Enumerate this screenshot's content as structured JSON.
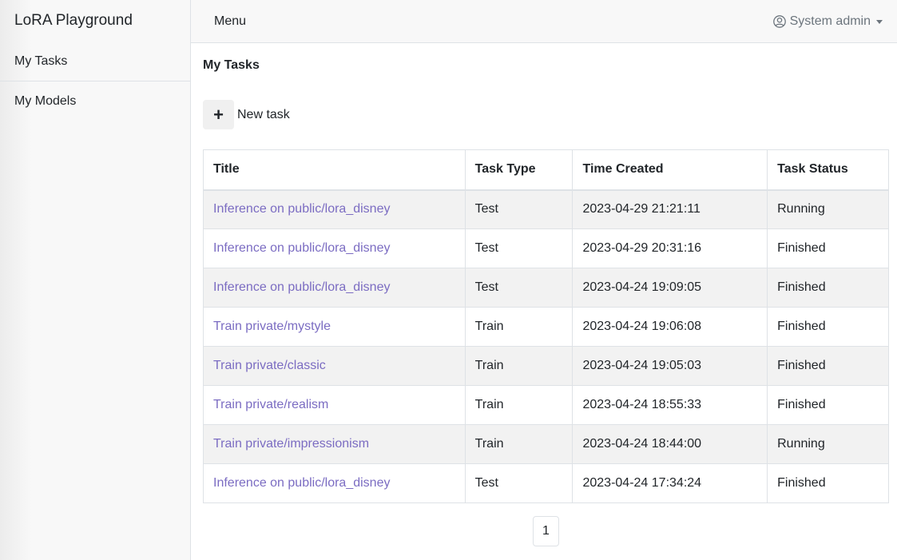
{
  "sidebar": {
    "brand": "LoRA Playground",
    "items": [
      {
        "label": "My Tasks"
      },
      {
        "label": "My Models"
      }
    ]
  },
  "topbar": {
    "menu_label": "Menu",
    "user_label": "System admin",
    "user_icon": "user-circle-icon"
  },
  "main": {
    "title": "My Tasks",
    "new_task": {
      "icon": "plus-icon",
      "label": "New task"
    },
    "table": {
      "headers": [
        "Title",
        "Task Type",
        "Time Created",
        "Task Status"
      ],
      "rows": [
        {
          "title": "Inference on public/lora_disney",
          "type": "Test",
          "time": "2023-04-29 21:21:11",
          "status": "Running"
        },
        {
          "title": "Inference on public/lora_disney",
          "type": "Test",
          "time": "2023-04-29 20:31:16",
          "status": "Finished"
        },
        {
          "title": "Inference on public/lora_disney",
          "type": "Test",
          "time": "2023-04-24 19:09:05",
          "status": "Finished"
        },
        {
          "title": "Train private/mystyle",
          "type": "Train",
          "time": "2023-04-24 19:06:08",
          "status": "Finished"
        },
        {
          "title": "Train private/classic",
          "type": "Train",
          "time": "2023-04-24 19:05:03",
          "status": "Finished"
        },
        {
          "title": "Train private/realism",
          "type": "Train",
          "time": "2023-04-24 18:55:33",
          "status": "Finished"
        },
        {
          "title": "Train private/impressionism",
          "type": "Train",
          "time": "2023-04-24 18:44:00",
          "status": "Running"
        },
        {
          "title": "Inference on public/lora_disney",
          "type": "Test",
          "time": "2023-04-24 17:34:24",
          "status": "Finished"
        }
      ]
    },
    "pagination": {
      "current_page": "1"
    }
  },
  "colors": {
    "link": "#7b6cc2",
    "stripe": "#f2f2f2",
    "sidebar_bg": "#f8f8f8",
    "border": "#dee2e6"
  }
}
